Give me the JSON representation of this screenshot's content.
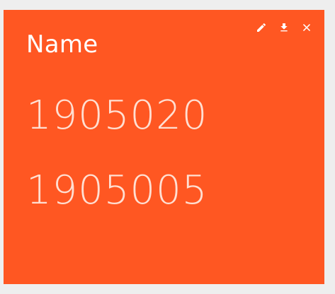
{
  "card": {
    "title": "Name",
    "values": [
      "1905020",
      "1905005"
    ],
    "background_color": "#ff5722"
  },
  "toolbar": {
    "edit_icon": "pencil-icon",
    "download_icon": "download-icon",
    "close_icon": "close-icon"
  }
}
